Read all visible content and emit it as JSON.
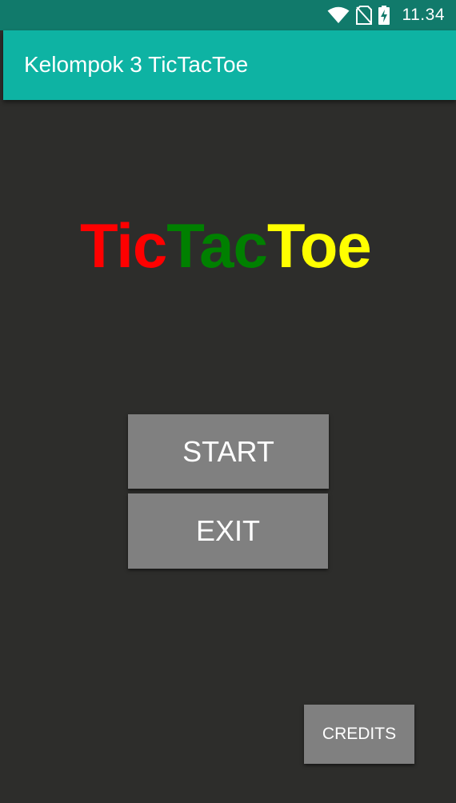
{
  "status_bar": {
    "time": "11.34",
    "icons": [
      "wifi-icon",
      "no-sim-icon",
      "battery-charging-icon"
    ]
  },
  "app_bar": {
    "title": "Kelompok 3 TicTacToe"
  },
  "logo": {
    "parts": [
      {
        "text": "Tic",
        "color": "#ff0000"
      },
      {
        "text": "Tac",
        "color": "#008000"
      },
      {
        "text": "Toe",
        "color": "#ffff00"
      }
    ]
  },
  "buttons": {
    "start": "START",
    "exit": "EXIT",
    "credits": "CREDITS"
  },
  "colors": {
    "status_bar": "#117a6b",
    "app_bar": "#0eb3a3",
    "background": "#2d2d2b",
    "button": "#808080"
  }
}
